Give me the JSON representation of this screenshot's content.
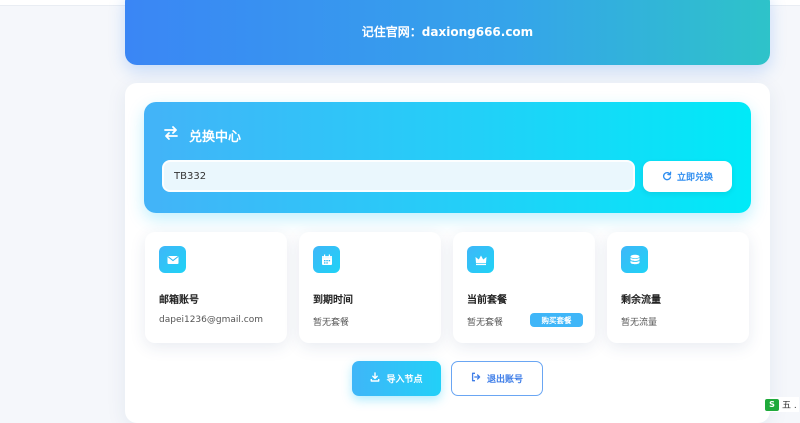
{
  "banner": {
    "text": "记住官网：daxiong666.com"
  },
  "redeem": {
    "title": "兑换中心",
    "title_icon": "swap-icon",
    "input_value": "TB332",
    "button_label": "立即兑换",
    "button_icon": "refresh-icon"
  },
  "stats": [
    {
      "icon": "envelope-icon",
      "label": "邮箱账号",
      "value": "dapei1236@gmail.com"
    },
    {
      "icon": "calendar-icon",
      "label": "到期时间",
      "value": "暂无套餐"
    },
    {
      "icon": "crown-icon",
      "label": "当前套餐",
      "value": "暂无套餐",
      "action_label": "购买套餐"
    },
    {
      "icon": "database-icon",
      "label": "剩余流量",
      "value": "暂无流量"
    }
  ],
  "actions": {
    "import_label": "导入节点",
    "logout_label": "退出账号"
  },
  "corner": {
    "logo_text": "S",
    "text": "五 ."
  },
  "colors": {
    "accent": "#22d0f8",
    "banner_start": "#3a86f5",
    "banner_end": "#2ec3c9",
    "button_text": "#2f8ef0"
  }
}
